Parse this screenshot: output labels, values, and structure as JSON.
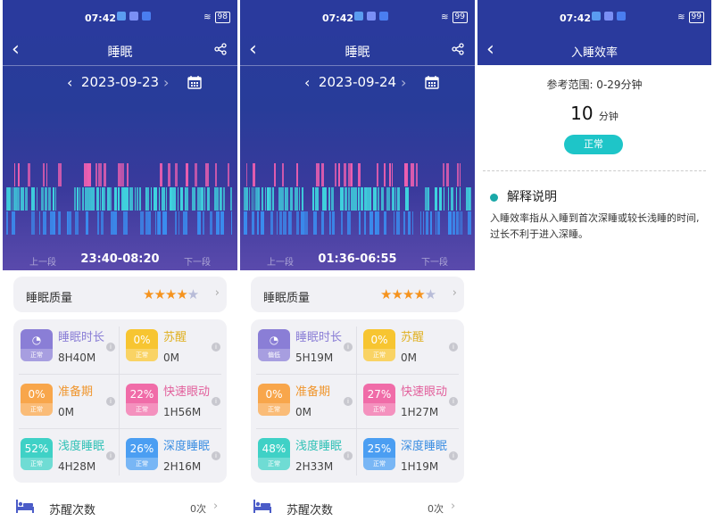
{
  "status": {
    "time": "07:42",
    "battery1": "98",
    "battery2": "99"
  },
  "screens": [
    {
      "title": "睡眠",
      "date": "2023-09-23",
      "prev_segment": "上一段",
      "next_segment": "下一段",
      "time_range": "23:40-08:20",
      "quality_label": "睡眠质量",
      "quality_stars": 4,
      "stats": [
        {
          "name": "睡眠时长",
          "value": "8H40M",
          "pct": "",
          "status": "正常",
          "color": "#8a7ed6",
          "text_color": "#8a7ed6"
        },
        {
          "name": "苏醒",
          "value": "0M",
          "pct": "0%",
          "status": "正常",
          "color": "#f7c531",
          "text_color": "#e0b020"
        },
        {
          "name": "准备期",
          "value": "0M",
          "pct": "0%",
          "status": "正常",
          "color": "#f8a64b",
          "text_color": "#f0962e"
        },
        {
          "name": "快速眼动",
          "value": "1H56M",
          "pct": "22%",
          "status": "正常",
          "color": "#f06ca8",
          "text_color": "#e2609c"
        },
        {
          "name": "浅度睡眠",
          "value": "4H28M",
          "pct": "52%",
          "status": "正常",
          "color": "#3fd1c6",
          "text_color": "#2fc1b6"
        },
        {
          "name": "深度睡眠",
          "value": "2H16M",
          "pct": "26%",
          "status": "正常",
          "color": "#4b9ef2",
          "text_color": "#3b8ee2"
        }
      ],
      "wake_label": "苏醒次数",
      "wake_count": "0次"
    },
    {
      "title": "睡眠",
      "date": "2023-09-24",
      "prev_segment": "上一段",
      "next_segment": "下一段",
      "time_range": "01:36-06:55",
      "quality_label": "睡眠质量",
      "quality_stars": 4,
      "stats": [
        {
          "name": "睡眠时长",
          "value": "5H19M",
          "pct": "",
          "status": "偏低",
          "color": "#8a7ed6",
          "text_color": "#8a7ed6"
        },
        {
          "name": "苏醒",
          "value": "0M",
          "pct": "0%",
          "status": "正常",
          "color": "#f7c531",
          "text_color": "#e0b020"
        },
        {
          "name": "准备期",
          "value": "0M",
          "pct": "0%",
          "status": "正常",
          "color": "#f8a64b",
          "text_color": "#f0962e"
        },
        {
          "name": "快速眼动",
          "value": "1H27M",
          "pct": "27%",
          "status": "正常",
          "color": "#f06ca8",
          "text_color": "#e2609c"
        },
        {
          "name": "浅度睡眠",
          "value": "2H33M",
          "pct": "48%",
          "status": "正常",
          "color": "#3fd1c6",
          "text_color": "#2fc1b6"
        },
        {
          "name": "深度睡眠",
          "value": "1H19M",
          "pct": "25%",
          "status": "正常",
          "color": "#4b9ef2",
          "text_color": "#3b8ee2"
        }
      ],
      "wake_label": "苏醒次数",
      "wake_count": "0次"
    }
  ],
  "detail": {
    "title": "入睡效率",
    "reference": "参考范围: 0-29分钟",
    "value": "10",
    "unit": "分钟",
    "status": "正常",
    "explain_title": "解释说明",
    "explain_text": "入睡效率指从入睡到首次深睡或较长浅睡的时间,过长不利于进入深睡。"
  },
  "colors": {
    "header": "#2a3a9d",
    "rem": "#f060b0",
    "light": "#3fd6e0",
    "deep": "#3a8ef0",
    "accent": "#1ec5c8"
  }
}
